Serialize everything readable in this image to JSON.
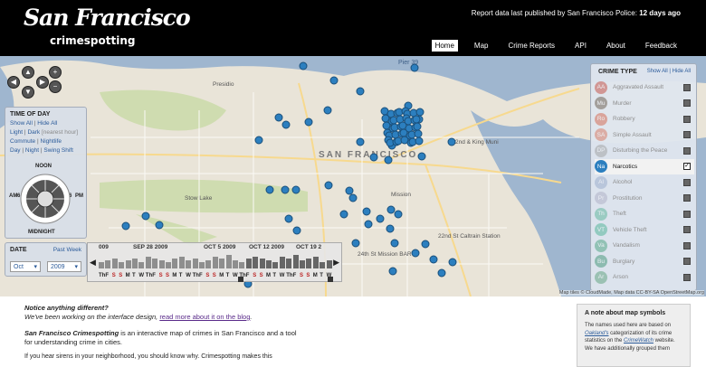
{
  "header": {
    "logo_title": "San Francisco",
    "logo_subtitle": "crimespotting",
    "report_prefix": "Report data last published by San Francisco Police: ",
    "report_age": "12 days ago",
    "nav": [
      {
        "label": "Home",
        "active": true
      },
      {
        "label": "Map",
        "active": false
      },
      {
        "label": "Crime Reports",
        "active": false
      },
      {
        "label": "API",
        "active": false
      },
      {
        "label": "About",
        "active": false
      },
      {
        "label": "Feedback",
        "active": false
      }
    ]
  },
  "map": {
    "labels": {
      "presidio": "Presidio",
      "sf": "SAN FRANCISCO",
      "stow": "Stow Lake",
      "king": "2nd & King Muni",
      "caltrain": "22nd St Caltrain Station",
      "bart": "24th St Mission BART",
      "mission": "Mission",
      "pier": "Pier 39"
    },
    "controls": {
      "up": "▲",
      "down": "▼",
      "left": "◀",
      "right": "▶",
      "zoom_in": "+",
      "zoom_out": "−"
    },
    "attribution": "Map tiles © CloudMade, Map data CC-BY-SA OpenStreetMap.org"
  },
  "time_panel": {
    "title": "TIME OF DAY",
    "show_all": "Show All",
    "hide_all": "Hide All",
    "light": "Light",
    "dark": "Dark",
    "nearest_hour": "[nearest hour]",
    "commute": "Commute",
    "nightlife": "Nightlife",
    "day": "Day",
    "night": "Night",
    "swing_shift": "Swing Shift",
    "noon": "NOON",
    "midnight": "MIDNIGHT",
    "am": "AM",
    "pm": "PM",
    "n6": "6",
    "n6b": "6"
  },
  "date_panel": {
    "title": "DATE",
    "past_week": "Past Week",
    "month": "Oct",
    "year": "2009"
  },
  "timeline": {
    "left_arrow": "◀",
    "right_arrow": "▶",
    "dates": [
      "009",
      "SEP 28 2009",
      "OCT 5 2009",
      "OCT 12 2009",
      "OCT 19 2"
    ],
    "days": [
      "Th",
      "F",
      "S",
      "S",
      "M",
      "T",
      "W",
      "Th",
      "F",
      "S",
      "S",
      "M",
      "T",
      "W",
      "Th",
      "F",
      "S",
      "S",
      "M",
      "T",
      "W",
      "Th",
      "F",
      "S",
      "S",
      "M",
      "T",
      "W",
      "Th",
      "F",
      "S",
      "S",
      "M",
      "T",
      "W"
    ],
    "counts": [
      3,
      4,
      5,
      3,
      4,
      5,
      3,
      6,
      5,
      4,
      3,
      5,
      6,
      4,
      5,
      3,
      4,
      6,
      5,
      7,
      4,
      3,
      5,
      6,
      5,
      4,
      3,
      6,
      5,
      7,
      4,
      5,
      6,
      3,
      4
    ]
  },
  "crime_panel": {
    "title": "CRIME TYPE",
    "show_all": "Show All",
    "hide_all": "Hide All",
    "items": [
      {
        "abbr": "AA",
        "name": "Aggravated Assault",
        "color": "#c0392b",
        "active": false
      },
      {
        "abbr": "Mu",
        "name": "Murder",
        "color": "#5b4a3a",
        "active": false
      },
      {
        "abbr": "Ro",
        "name": "Robbery",
        "color": "#d2553a",
        "active": false
      },
      {
        "abbr": "SA",
        "name": "Simple Assault",
        "color": "#d66a50",
        "active": false
      },
      {
        "abbr": "DP",
        "name": "Disturbing the Peace",
        "color": "#999999",
        "active": false
      },
      {
        "abbr": "Na",
        "name": "Narcotics",
        "color": "#2c7fbf",
        "active": true
      },
      {
        "abbr": "Al",
        "name": "Alcohol",
        "color": "#8fa3c6",
        "active": false
      },
      {
        "abbr": "Pr",
        "name": "Prostitution",
        "color": "#a8a8c0",
        "active": false
      },
      {
        "abbr": "Th",
        "name": "Theft",
        "color": "#4caf8f",
        "active": false
      },
      {
        "abbr": "VT",
        "name": "Vehicle Theft",
        "color": "#3cae8a",
        "active": false
      },
      {
        "abbr": "Va",
        "name": "Vandalism",
        "color": "#3a9c73",
        "active": false
      },
      {
        "abbr": "Bu",
        "name": "Burglary",
        "color": "#2f8c67",
        "active": false
      },
      {
        "abbr": "Ar",
        "name": "Arson",
        "color": "#4d9a6e",
        "active": false
      }
    ],
    "check": "✓"
  },
  "content": {
    "notice_q": "Notice anything different?",
    "notice_text": "We've been working on the interface design, ",
    "notice_link": "read more about it on the blog",
    "notice_end": ".",
    "about_bold": "San Francisco Crimespotting",
    "about_text": " is an interactive map of crimes in San Francisco and a tool for understanding crime in cities.",
    "sirens_text": "If you hear sirens in your neighborhood, you should know why. Crimespotting makes this"
  },
  "note_box": {
    "title": "A note about map symbols",
    "p1": "The names used here are based on ",
    "link1": "Oakland's",
    "p2": " categorization of its crime statistics on the ",
    "link2": "CrimeWatch",
    "p3": " website. We have additionally grouped them"
  }
}
